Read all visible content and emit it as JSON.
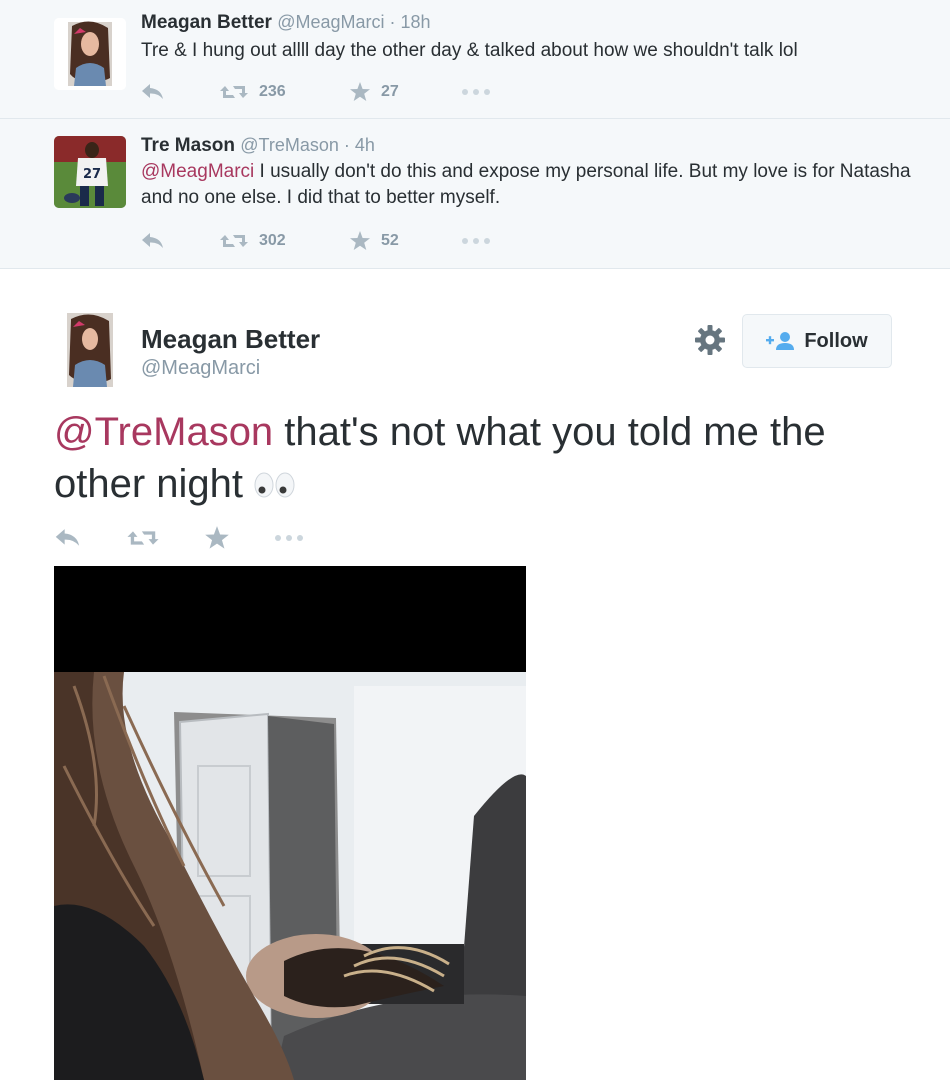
{
  "tweets": [
    {
      "name": "Meagan Better",
      "meta": "@MeagMarci · 18h",
      "text": "Tre & I hung out allll day the other day & talked about how we shouldn't talk lol",
      "retweets": "236",
      "favorites": "27",
      "avatar_icon": "avatar-meagan-icon"
    },
    {
      "name": "Tre Mason",
      "meta": "@TreMason · 4h",
      "mention": "@MeagMarci",
      "text": " I usually don't do this and expose my personal life. But my love is for Natasha and no one else. I did that to better myself.",
      "retweets": "302",
      "favorites": "52",
      "avatar_icon": "avatar-tre-icon",
      "jersey_number": "27"
    }
  ],
  "main_tweet": {
    "name": "Meagan Better",
    "handle": "@MeagMarci",
    "follow_label": "Follow",
    "mention": "@TreMason",
    "text": " that's not what you told me the other night",
    "emoji_icon": "eyes-emoji-icon"
  },
  "colors": {
    "mention": "#a8385f",
    "meta": "#8899a6",
    "background_convo": "#f5f8fa",
    "follow_icon": "#55acee"
  }
}
